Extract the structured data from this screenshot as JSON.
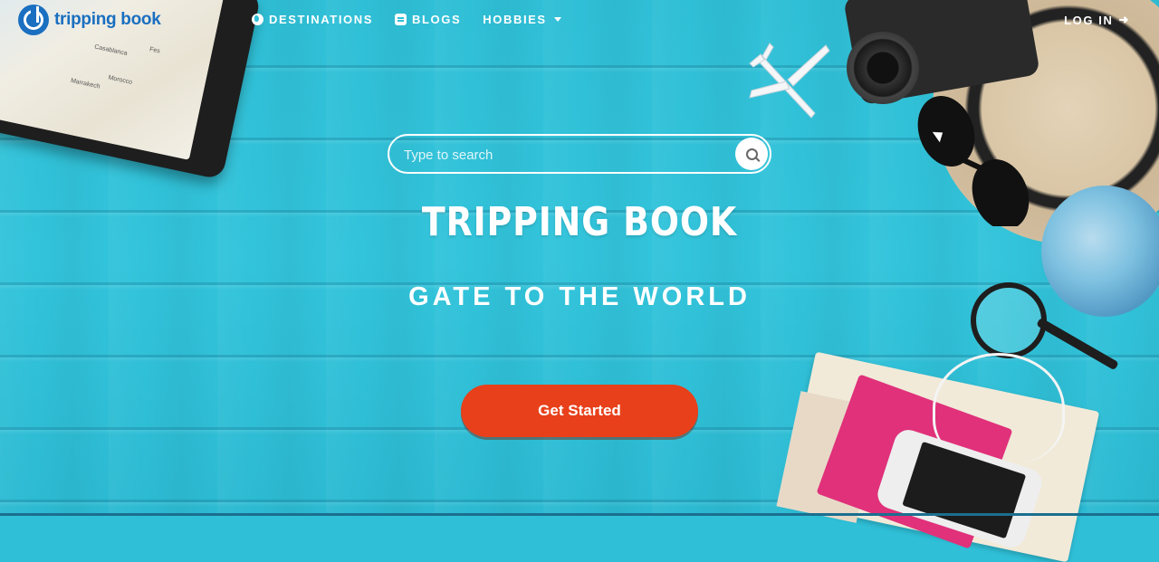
{
  "brand": {
    "name": "tripping book"
  },
  "nav": {
    "items": [
      {
        "label": "DESTINATIONS",
        "icon": "globe-icon"
      },
      {
        "label": "BLOGS",
        "icon": "blog-icon"
      },
      {
        "label": "HOBBIES",
        "icon": "caret-down-icon"
      }
    ],
    "login_label": "LOG IN",
    "login_icon": "sign-in-icon"
  },
  "search": {
    "placeholder": "Type to search",
    "value": ""
  },
  "hero": {
    "title": "TRIPPING BOOK",
    "subtitle": "GATE TO THE WORLD",
    "cta_label": "Get Started"
  },
  "tablet_map": {
    "labels": [
      "Casablanca",
      "Morocco",
      "Marrakech",
      "Fes"
    ]
  },
  "colors": {
    "accent": "#e8401a",
    "brand": "#1a6fc0",
    "background": "#2fc0d8"
  }
}
